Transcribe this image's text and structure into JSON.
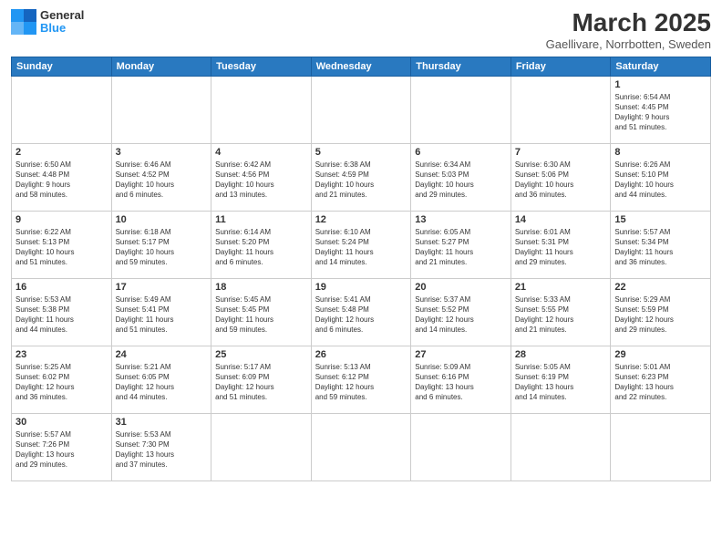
{
  "header": {
    "logo": {
      "general": "General",
      "blue": "Blue"
    },
    "title": "March 2025",
    "location": "Gaellivare, Norrbotten, Sweden"
  },
  "weekdays": [
    "Sunday",
    "Monday",
    "Tuesday",
    "Wednesday",
    "Thursday",
    "Friday",
    "Saturday"
  ],
  "weeks": [
    [
      {
        "day": "",
        "info": ""
      },
      {
        "day": "",
        "info": ""
      },
      {
        "day": "",
        "info": ""
      },
      {
        "day": "",
        "info": ""
      },
      {
        "day": "",
        "info": ""
      },
      {
        "day": "",
        "info": ""
      },
      {
        "day": "1",
        "info": "Sunrise: 6:54 AM\nSunset: 4:45 PM\nDaylight: 9 hours\nand 51 minutes."
      }
    ],
    [
      {
        "day": "2",
        "info": "Sunrise: 6:50 AM\nSunset: 4:48 PM\nDaylight: 9 hours\nand 58 minutes."
      },
      {
        "day": "3",
        "info": "Sunrise: 6:46 AM\nSunset: 4:52 PM\nDaylight: 10 hours\nand 6 minutes."
      },
      {
        "day": "4",
        "info": "Sunrise: 6:42 AM\nSunset: 4:56 PM\nDaylight: 10 hours\nand 13 minutes."
      },
      {
        "day": "5",
        "info": "Sunrise: 6:38 AM\nSunset: 4:59 PM\nDaylight: 10 hours\nand 21 minutes."
      },
      {
        "day": "6",
        "info": "Sunrise: 6:34 AM\nSunset: 5:03 PM\nDaylight: 10 hours\nand 29 minutes."
      },
      {
        "day": "7",
        "info": "Sunrise: 6:30 AM\nSunset: 5:06 PM\nDaylight: 10 hours\nand 36 minutes."
      },
      {
        "day": "8",
        "info": "Sunrise: 6:26 AM\nSunset: 5:10 PM\nDaylight: 10 hours\nand 44 minutes."
      }
    ],
    [
      {
        "day": "9",
        "info": "Sunrise: 6:22 AM\nSunset: 5:13 PM\nDaylight: 10 hours\nand 51 minutes."
      },
      {
        "day": "10",
        "info": "Sunrise: 6:18 AM\nSunset: 5:17 PM\nDaylight: 10 hours\nand 59 minutes."
      },
      {
        "day": "11",
        "info": "Sunrise: 6:14 AM\nSunset: 5:20 PM\nDaylight: 11 hours\nand 6 minutes."
      },
      {
        "day": "12",
        "info": "Sunrise: 6:10 AM\nSunset: 5:24 PM\nDaylight: 11 hours\nand 14 minutes."
      },
      {
        "day": "13",
        "info": "Sunrise: 6:05 AM\nSunset: 5:27 PM\nDaylight: 11 hours\nand 21 minutes."
      },
      {
        "day": "14",
        "info": "Sunrise: 6:01 AM\nSunset: 5:31 PM\nDaylight: 11 hours\nand 29 minutes."
      },
      {
        "day": "15",
        "info": "Sunrise: 5:57 AM\nSunset: 5:34 PM\nDaylight: 11 hours\nand 36 minutes."
      }
    ],
    [
      {
        "day": "16",
        "info": "Sunrise: 5:53 AM\nSunset: 5:38 PM\nDaylight: 11 hours\nand 44 minutes."
      },
      {
        "day": "17",
        "info": "Sunrise: 5:49 AM\nSunset: 5:41 PM\nDaylight: 11 hours\nand 51 minutes."
      },
      {
        "day": "18",
        "info": "Sunrise: 5:45 AM\nSunset: 5:45 PM\nDaylight: 11 hours\nand 59 minutes."
      },
      {
        "day": "19",
        "info": "Sunrise: 5:41 AM\nSunset: 5:48 PM\nDaylight: 12 hours\nand 6 minutes."
      },
      {
        "day": "20",
        "info": "Sunrise: 5:37 AM\nSunset: 5:52 PM\nDaylight: 12 hours\nand 14 minutes."
      },
      {
        "day": "21",
        "info": "Sunrise: 5:33 AM\nSunset: 5:55 PM\nDaylight: 12 hours\nand 21 minutes."
      },
      {
        "day": "22",
        "info": "Sunrise: 5:29 AM\nSunset: 5:59 PM\nDaylight: 12 hours\nand 29 minutes."
      }
    ],
    [
      {
        "day": "23",
        "info": "Sunrise: 5:25 AM\nSunset: 6:02 PM\nDaylight: 12 hours\nand 36 minutes."
      },
      {
        "day": "24",
        "info": "Sunrise: 5:21 AM\nSunset: 6:05 PM\nDaylight: 12 hours\nand 44 minutes."
      },
      {
        "day": "25",
        "info": "Sunrise: 5:17 AM\nSunset: 6:09 PM\nDaylight: 12 hours\nand 51 minutes."
      },
      {
        "day": "26",
        "info": "Sunrise: 5:13 AM\nSunset: 6:12 PM\nDaylight: 12 hours\nand 59 minutes."
      },
      {
        "day": "27",
        "info": "Sunrise: 5:09 AM\nSunset: 6:16 PM\nDaylight: 13 hours\nand 6 minutes."
      },
      {
        "day": "28",
        "info": "Sunrise: 5:05 AM\nSunset: 6:19 PM\nDaylight: 13 hours\nand 14 minutes."
      },
      {
        "day": "29",
        "info": "Sunrise: 5:01 AM\nSunset: 6:23 PM\nDaylight: 13 hours\nand 22 minutes."
      }
    ],
    [
      {
        "day": "30",
        "info": "Sunrise: 5:57 AM\nSunset: 7:26 PM\nDaylight: 13 hours\nand 29 minutes."
      },
      {
        "day": "31",
        "info": "Sunrise: 5:53 AM\nSunset: 7:30 PM\nDaylight: 13 hours\nand 37 minutes."
      },
      {
        "day": "",
        "info": ""
      },
      {
        "day": "",
        "info": ""
      },
      {
        "day": "",
        "info": ""
      },
      {
        "day": "",
        "info": ""
      },
      {
        "day": "",
        "info": ""
      }
    ]
  ]
}
